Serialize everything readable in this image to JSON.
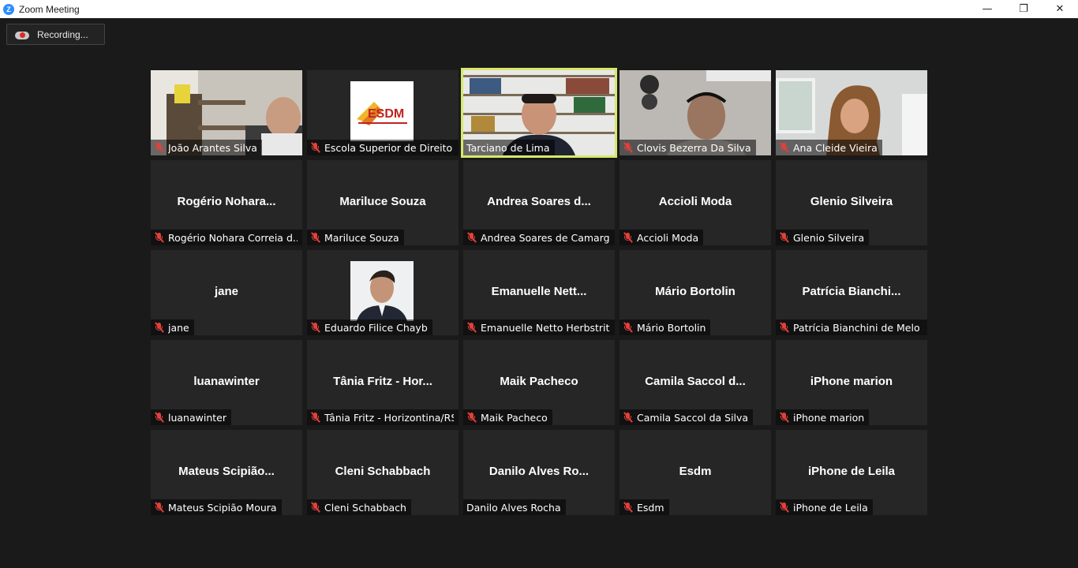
{
  "window": {
    "title": "Zoom Meeting",
    "controls": {
      "minimize": "—",
      "restore": "❐",
      "close": "✕"
    }
  },
  "recording": {
    "label": "Recording..."
  },
  "tiles": [
    {
      "center": "",
      "label": "João Arantes Silva",
      "muted": true
    },
    {
      "center": "",
      "label": "Escola Superior de Direito ...",
      "muted": true
    },
    {
      "center": "",
      "label": "Tarciano de Lima",
      "muted": false
    },
    {
      "center": "",
      "label": "Clovis Bezerra Da Silva",
      "muted": true
    },
    {
      "center": "",
      "label": "Ana Cleide Vieira",
      "muted": true
    },
    {
      "center": "Rogério  Nohara...",
      "label": "Rogério Nohara Correia d...",
      "muted": true
    },
    {
      "center": "Mariluce Souza",
      "label": "Mariluce Souza",
      "muted": true
    },
    {
      "center": "Andrea Soares d...",
      "label": "Andrea Soares de Camargo",
      "muted": true
    },
    {
      "center": "Accioli Moda",
      "label": "Accioli Moda",
      "muted": true
    },
    {
      "center": "Glenio Silveira",
      "label": "Glenio Silveira",
      "muted": true
    },
    {
      "center": "jane",
      "label": "jane",
      "muted": true
    },
    {
      "center": "",
      "label": "Eduardo Filice Chayb",
      "muted": true
    },
    {
      "center": "Emanuelle  Nett...",
      "label": "Emanuelle Netto Herbstrith",
      "muted": true
    },
    {
      "center": "Mário Bortolin",
      "label": "Mário Bortolin",
      "muted": true
    },
    {
      "center": "Patrícia  Bianchi...",
      "label": "Patrícia Bianchini de Melo ...",
      "muted": true
    },
    {
      "center": "luanawinter",
      "label": "luanawinter",
      "muted": true
    },
    {
      "center": "Tânia Fritz - Hor...",
      "label": "Tânia Fritz - Horizontina/RS",
      "muted": true
    },
    {
      "center": "Maik Pacheco",
      "label": "Maik Pacheco",
      "muted": true
    },
    {
      "center": "Camila  Saccol  d...",
      "label": "Camila Saccol da Silva",
      "muted": true
    },
    {
      "center": "iPhone marion",
      "label": "iPhone marion",
      "muted": true
    },
    {
      "center": "Mateus  Scipião...",
      "label": "Mateus Scipião Moura",
      "muted": true
    },
    {
      "center": "Cleni Schabbach",
      "label": "Cleni Schabbach",
      "muted": true
    },
    {
      "center": "Danilo Alves Ro...",
      "label": "Danilo Alves Rocha",
      "muted": false
    },
    {
      "center": "Esdm",
      "label": "Esdm",
      "muted": true
    },
    {
      "center": "iPhone de Leila",
      "label": "iPhone de Leila",
      "muted": true
    }
  ],
  "logo_text": "ESDM",
  "colors": {
    "active_speaker": "#d8e86a",
    "muted_icon": "#e2403b",
    "tile_bg": "#262626"
  }
}
